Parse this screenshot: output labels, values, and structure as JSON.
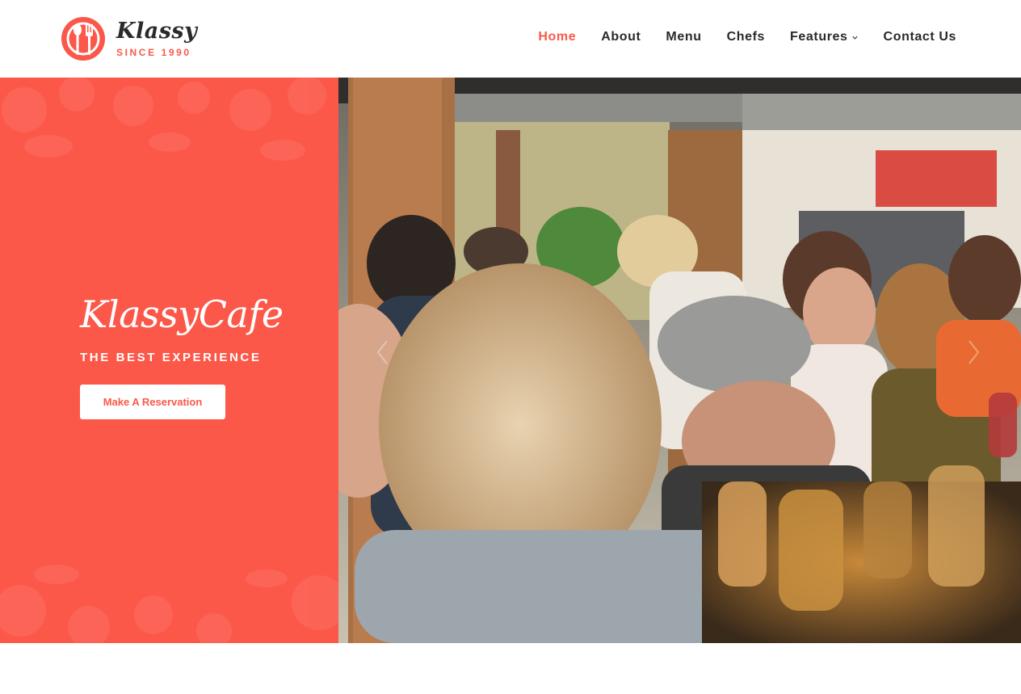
{
  "brand": {
    "name": "Klassy",
    "since": "SINCE 1990",
    "icon": "fork-spoon-badge-icon"
  },
  "nav": {
    "items": [
      {
        "label": "Home",
        "active": true
      },
      {
        "label": "About",
        "active": false
      },
      {
        "label": "Menu",
        "active": false
      },
      {
        "label": "Chefs",
        "active": false
      },
      {
        "label": "Features",
        "active": false,
        "has_dropdown": true
      },
      {
        "label": "Contact Us",
        "active": false
      }
    ]
  },
  "hero": {
    "title": "KlassyCafe",
    "subtitle": "THE BEST EXPERIENCE",
    "cta_label": "Make A Reservation",
    "prev_icon": "chevron-left-icon",
    "next_icon": "chevron-right-icon"
  },
  "colors": {
    "accent": "#fb5849",
    "text": "#2a2a2a",
    "background": "#ffffff"
  }
}
